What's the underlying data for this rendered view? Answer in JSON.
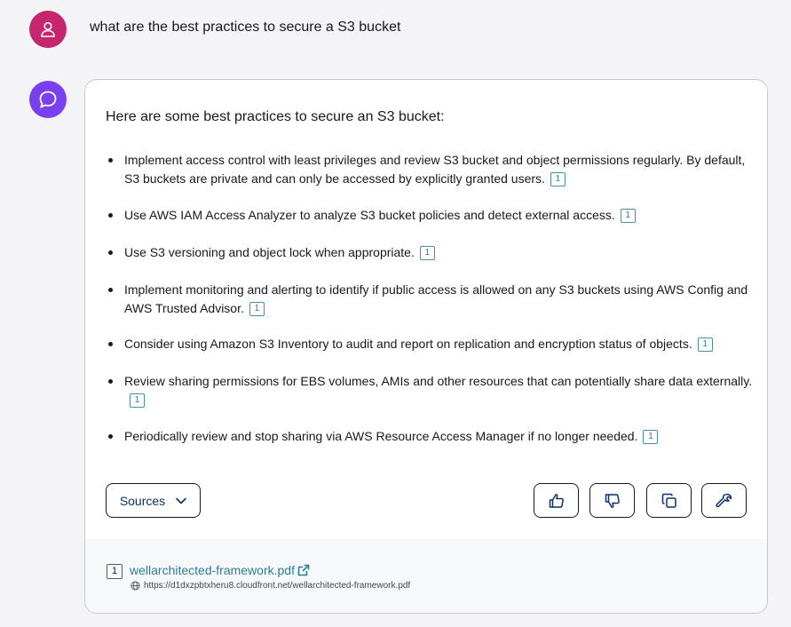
{
  "user_message": {
    "text": "what are the best practices to secure a S3 bucket",
    "avatar_icon": "user-icon",
    "avatar_color": "#c6266f"
  },
  "assistant": {
    "avatar_icon": "chat-bubble-icon",
    "avatar_color": "#7b3ff2",
    "intro": "Here are some best practices to secure an S3 bucket:",
    "bullets": [
      {
        "text": "Implement access control with least privileges and review S3 bucket and object permissions regularly. By default, S3 buckets are private and can only be accessed by explicitly granted users.",
        "citation": "1"
      },
      {
        "text": "Use AWS IAM Access Analyzer to analyze S3 bucket policies and detect external access.",
        "citation": "1"
      },
      {
        "text": "Use S3 versioning and object lock when appropriate.",
        "citation": "1"
      },
      {
        "text": "Implement monitoring and alerting to identify if public access is allowed on any S3 buckets using AWS Config and AWS Trusted Advisor.",
        "citation": "1"
      },
      {
        "text": "Consider using Amazon S3 Inventory to audit and report on replication and encryption status of objects.",
        "citation": "1"
      },
      {
        "text": "Review sharing permissions for EBS volumes, AMIs and other resources that can potentially share data externally.",
        "citation": "1"
      },
      {
        "text": "Periodically review and stop sharing via AWS Resource Access Manager if no longer needed.",
        "citation": "1"
      }
    ],
    "actions": {
      "sources_label": "Sources",
      "buttons": [
        "thumbs-up-icon",
        "thumbs-down-icon",
        "copy-icon",
        "wrench-icon"
      ]
    },
    "sources": [
      {
        "number": "1",
        "title": "wellarchitected-framework.pdf",
        "url": "https://d1dxzpbtxheru8.cloudfront.net/wellarchitected-framework.pdf"
      }
    ]
  },
  "colors": {
    "link": "#2a7f96",
    "button_text": "#0f2f67",
    "page_bg": "#f4f4f6"
  }
}
